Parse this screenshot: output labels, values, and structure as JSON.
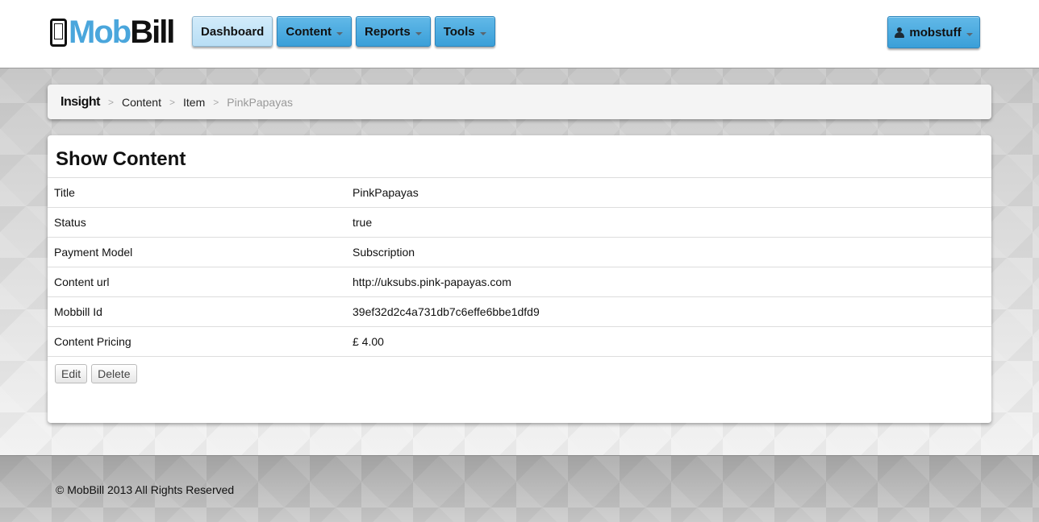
{
  "header": {
    "logo": {
      "part1": "Mob",
      "part2": "Bill"
    },
    "nav": [
      {
        "label": "Dashboard",
        "active": true,
        "dropdown": false
      },
      {
        "label": "Content",
        "active": false,
        "dropdown": true
      },
      {
        "label": "Reports",
        "active": false,
        "dropdown": true
      },
      {
        "label": "Tools",
        "active": false,
        "dropdown": true
      }
    ],
    "user": {
      "name": "mobstuff",
      "icon": "user-icon"
    }
  },
  "breadcrumb": {
    "brand": "Insight",
    "items": [
      "Content",
      "Item"
    ],
    "current": "PinkPapayas",
    "separator": ">"
  },
  "main": {
    "heading": "Show Content",
    "rows": [
      {
        "label": "Title",
        "value": "PinkPapayas"
      },
      {
        "label": "Status",
        "value": "true"
      },
      {
        "label": "Payment Model",
        "value": "Subscription"
      },
      {
        "label": "Content url",
        "value": "http://uksubs.pink-papayas.com"
      },
      {
        "label": "Mobbill Id",
        "value": "39ef32d2c4a731db7c6effe6bbe1dfd9"
      },
      {
        "label": "Content Pricing",
        "value": "£ 4.00"
      }
    ],
    "actions": {
      "edit": "Edit",
      "delete": "Delete"
    }
  },
  "footer": {
    "text": "© MobBill 2013 All Rights Reserved"
  },
  "colors": {
    "accent": "#3a9fd8",
    "accent_light": "#b8def5",
    "logo_blue": "#4aa6dc"
  }
}
